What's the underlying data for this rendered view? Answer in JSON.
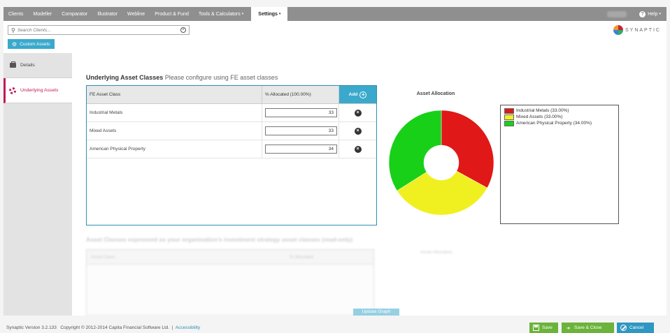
{
  "nav": {
    "items": [
      {
        "label": "Clients",
        "dropdown": false,
        "active": false
      },
      {
        "label": "Modeller",
        "dropdown": false,
        "active": false
      },
      {
        "label": "Comparator",
        "dropdown": false,
        "active": false
      },
      {
        "label": "Illustrator",
        "dropdown": false,
        "active": false
      },
      {
        "label": "Webline",
        "dropdown": false,
        "active": false
      },
      {
        "label": "Product & Fund",
        "dropdown": false,
        "active": false
      },
      {
        "label": "Tools & Calculators",
        "dropdown": true,
        "active": false
      },
      {
        "label": "Settings",
        "dropdown": true,
        "active": true
      }
    ],
    "help_label": "Help",
    "caret": "▾"
  },
  "search": {
    "placeholder": "Search Clients..."
  },
  "custom_assets_label": "Custom Assets",
  "logo_text": "SYNAPTIC",
  "sidebar": {
    "items": [
      {
        "label": "Details",
        "icon": "briefcase-icon",
        "active": false
      },
      {
        "label": "Underlying Assets",
        "icon": "lifering-icon",
        "active": true
      }
    ]
  },
  "heading": {
    "title": "Underlying Asset Classes",
    "subtitle": "Please configure using FE asset classes"
  },
  "table": {
    "col_class": "FE Asset Class",
    "col_allocated": "% Allocated (100.00%)",
    "add_label": "Add",
    "rows": [
      {
        "name": "Industrial Metals",
        "value": "33"
      },
      {
        "name": "Mixed Assets",
        "value": "33"
      },
      {
        "name": "American Physical Property",
        "value": "34"
      }
    ]
  },
  "chart_title": "Asset Allocation",
  "chart_data": {
    "type": "pie",
    "donut": true,
    "title": "Asset Allocation",
    "legend_position": "right",
    "slices": [
      {
        "label": "Industrial Metals (33.00%)",
        "value": 33,
        "color": "#e01818"
      },
      {
        "label": "Mixed Assets (33.00%)",
        "value": 33,
        "color": "#f0f020"
      },
      {
        "label": "American Physical Property (34.00%)",
        "value": 34,
        "color": "#18d018"
      }
    ]
  },
  "readonly_section": {
    "heading": "Asset Classes expressed as your organisation's investment strategy asset classes (read-only)",
    "col_class": "Asset Class",
    "col_allocated": "% Allocated",
    "chart_title": "Asset Allocation"
  },
  "update_graph_label": "Update Graph",
  "footer": {
    "version": "Synaptic Version 3.2.133",
    "copyright": "Copyright © 2012-2014 Capita Financial Software Ltd.",
    "separator": "|",
    "accessibility": "Accessibility",
    "save_label": "Save",
    "save_close_label": "Save & Close",
    "cancel_label": "Cancel"
  }
}
